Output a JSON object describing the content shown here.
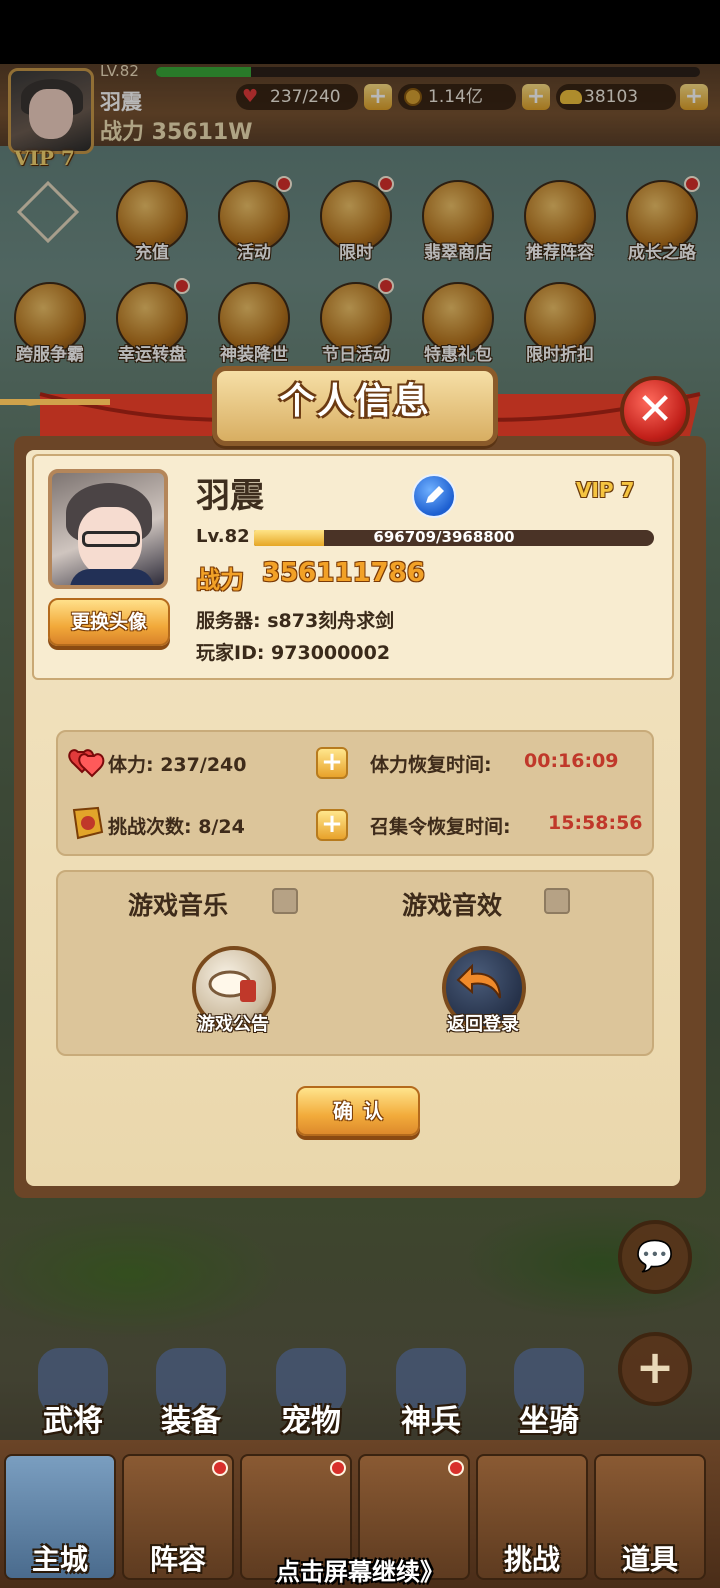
{
  "player": {
    "name": "羽震",
    "level_label": "LV.82",
    "level_label_panel": "Lv.82",
    "vip": "VIP 7",
    "power_short": "战力 35611W",
    "power_label": "战力",
    "power_value": "356111786",
    "xp_text": "696709/3968800",
    "xp_fraction": 0.1755,
    "server": "服务器: s873刻舟求剑",
    "player_id": "玩家ID: 973000002"
  },
  "resources": {
    "stamina": "237/240",
    "coins": "1.14亿",
    "ingots": "38103",
    "plus": "+"
  },
  "menu_row1": [
    {
      "label": "充值",
      "icon": "gold-ingots-icon",
      "dot": false
    },
    {
      "label": "活动",
      "icon": "trumpet-icon",
      "dot": true
    },
    {
      "label": "限时",
      "icon": "gift-box-icon",
      "dot": true
    },
    {
      "label": "翡翠商店",
      "icon": "jade-shop-icon",
      "dot": false
    },
    {
      "label": "推荐阵容",
      "icon": "crossed-swords-icon",
      "dot": false
    },
    {
      "label": "成长之路",
      "icon": "straw-hat-icon",
      "dot": true
    }
  ],
  "menu_row2": [
    {
      "label": "跨服争霸",
      "icon": "crossed-weapons-icon",
      "dot": false
    },
    {
      "label": "幸运转盘",
      "icon": "lucky-wheel-icon",
      "dot": true
    },
    {
      "label": "神装降世",
      "icon": "armor-icon",
      "dot": false
    },
    {
      "label": "节日活动",
      "icon": "festival-cup-icon",
      "dot": true
    },
    {
      "label": "特惠礼包",
      "icon": "gift-pack-icon",
      "dot": false
    },
    {
      "label": "限时折扣",
      "icon": "hourglass-icon",
      "dot": false
    }
  ],
  "dialog": {
    "title": "个人信息",
    "change_avatar": "更换头像",
    "stamina_label": "体力: 237/240",
    "stamina_recover_label": "体力恢复时间:",
    "stamina_recover_time": "00:16:09",
    "challenge_label": "挑战次数: 8/24",
    "summon_recover_label": "召集令恢复时间:",
    "summon_recover_time": "15:58:56",
    "music_label": "游戏音乐",
    "sfx_label": "游戏音效",
    "notice_label": "游戏公告",
    "back_login_label": "返回登录",
    "confirm": "确认",
    "close": "✕"
  },
  "lower_nav": [
    "武将",
    "装备",
    "宠物",
    "神兵",
    "坐骑"
  ],
  "bottom_tabs": [
    "主城",
    "阵容",
    "",
    "",
    "挑战",
    "道具"
  ],
  "continue_text": "点击屏幕继续》",
  "colors": {
    "accent_gold": "#f2a127",
    "timer_red": "#c0382a",
    "close_red": "#c2201a",
    "panel_brown": "#6b4527"
  }
}
